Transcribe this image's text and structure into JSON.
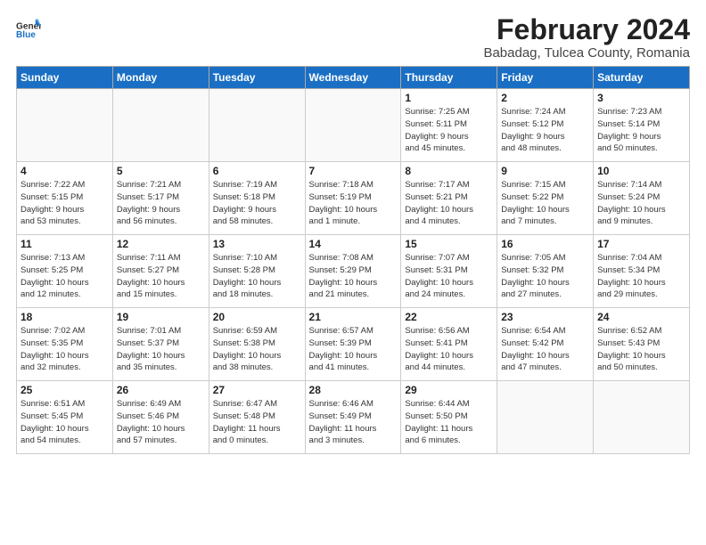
{
  "header": {
    "logo_line1": "General",
    "logo_line2": "Blue",
    "month_title": "February 2024",
    "location": "Babadag, Tulcea County, Romania"
  },
  "weekdays": [
    "Sunday",
    "Monday",
    "Tuesday",
    "Wednesday",
    "Thursday",
    "Friday",
    "Saturday"
  ],
  "weeks": [
    [
      {
        "day": "",
        "info": ""
      },
      {
        "day": "",
        "info": ""
      },
      {
        "day": "",
        "info": ""
      },
      {
        "day": "",
        "info": ""
      },
      {
        "day": "1",
        "info": "Sunrise: 7:25 AM\nSunset: 5:11 PM\nDaylight: 9 hours\nand 45 minutes."
      },
      {
        "day": "2",
        "info": "Sunrise: 7:24 AM\nSunset: 5:12 PM\nDaylight: 9 hours\nand 48 minutes."
      },
      {
        "day": "3",
        "info": "Sunrise: 7:23 AM\nSunset: 5:14 PM\nDaylight: 9 hours\nand 50 minutes."
      }
    ],
    [
      {
        "day": "4",
        "info": "Sunrise: 7:22 AM\nSunset: 5:15 PM\nDaylight: 9 hours\nand 53 minutes."
      },
      {
        "day": "5",
        "info": "Sunrise: 7:21 AM\nSunset: 5:17 PM\nDaylight: 9 hours\nand 56 minutes."
      },
      {
        "day": "6",
        "info": "Sunrise: 7:19 AM\nSunset: 5:18 PM\nDaylight: 9 hours\nand 58 minutes."
      },
      {
        "day": "7",
        "info": "Sunrise: 7:18 AM\nSunset: 5:19 PM\nDaylight: 10 hours\nand 1 minute."
      },
      {
        "day": "8",
        "info": "Sunrise: 7:17 AM\nSunset: 5:21 PM\nDaylight: 10 hours\nand 4 minutes."
      },
      {
        "day": "9",
        "info": "Sunrise: 7:15 AM\nSunset: 5:22 PM\nDaylight: 10 hours\nand 7 minutes."
      },
      {
        "day": "10",
        "info": "Sunrise: 7:14 AM\nSunset: 5:24 PM\nDaylight: 10 hours\nand 9 minutes."
      }
    ],
    [
      {
        "day": "11",
        "info": "Sunrise: 7:13 AM\nSunset: 5:25 PM\nDaylight: 10 hours\nand 12 minutes."
      },
      {
        "day": "12",
        "info": "Sunrise: 7:11 AM\nSunset: 5:27 PM\nDaylight: 10 hours\nand 15 minutes."
      },
      {
        "day": "13",
        "info": "Sunrise: 7:10 AM\nSunset: 5:28 PM\nDaylight: 10 hours\nand 18 minutes."
      },
      {
        "day": "14",
        "info": "Sunrise: 7:08 AM\nSunset: 5:29 PM\nDaylight: 10 hours\nand 21 minutes."
      },
      {
        "day": "15",
        "info": "Sunrise: 7:07 AM\nSunset: 5:31 PM\nDaylight: 10 hours\nand 24 minutes."
      },
      {
        "day": "16",
        "info": "Sunrise: 7:05 AM\nSunset: 5:32 PM\nDaylight: 10 hours\nand 27 minutes."
      },
      {
        "day": "17",
        "info": "Sunrise: 7:04 AM\nSunset: 5:34 PM\nDaylight: 10 hours\nand 29 minutes."
      }
    ],
    [
      {
        "day": "18",
        "info": "Sunrise: 7:02 AM\nSunset: 5:35 PM\nDaylight: 10 hours\nand 32 minutes."
      },
      {
        "day": "19",
        "info": "Sunrise: 7:01 AM\nSunset: 5:37 PM\nDaylight: 10 hours\nand 35 minutes."
      },
      {
        "day": "20",
        "info": "Sunrise: 6:59 AM\nSunset: 5:38 PM\nDaylight: 10 hours\nand 38 minutes."
      },
      {
        "day": "21",
        "info": "Sunrise: 6:57 AM\nSunset: 5:39 PM\nDaylight: 10 hours\nand 41 minutes."
      },
      {
        "day": "22",
        "info": "Sunrise: 6:56 AM\nSunset: 5:41 PM\nDaylight: 10 hours\nand 44 minutes."
      },
      {
        "day": "23",
        "info": "Sunrise: 6:54 AM\nSunset: 5:42 PM\nDaylight: 10 hours\nand 47 minutes."
      },
      {
        "day": "24",
        "info": "Sunrise: 6:52 AM\nSunset: 5:43 PM\nDaylight: 10 hours\nand 50 minutes."
      }
    ],
    [
      {
        "day": "25",
        "info": "Sunrise: 6:51 AM\nSunset: 5:45 PM\nDaylight: 10 hours\nand 54 minutes."
      },
      {
        "day": "26",
        "info": "Sunrise: 6:49 AM\nSunset: 5:46 PM\nDaylight: 10 hours\nand 57 minutes."
      },
      {
        "day": "27",
        "info": "Sunrise: 6:47 AM\nSunset: 5:48 PM\nDaylight: 11 hours\nand 0 minutes."
      },
      {
        "day": "28",
        "info": "Sunrise: 6:46 AM\nSunset: 5:49 PM\nDaylight: 11 hours\nand 3 minutes."
      },
      {
        "day": "29",
        "info": "Sunrise: 6:44 AM\nSunset: 5:50 PM\nDaylight: 11 hours\nand 6 minutes."
      },
      {
        "day": "",
        "info": ""
      },
      {
        "day": "",
        "info": ""
      }
    ]
  ]
}
